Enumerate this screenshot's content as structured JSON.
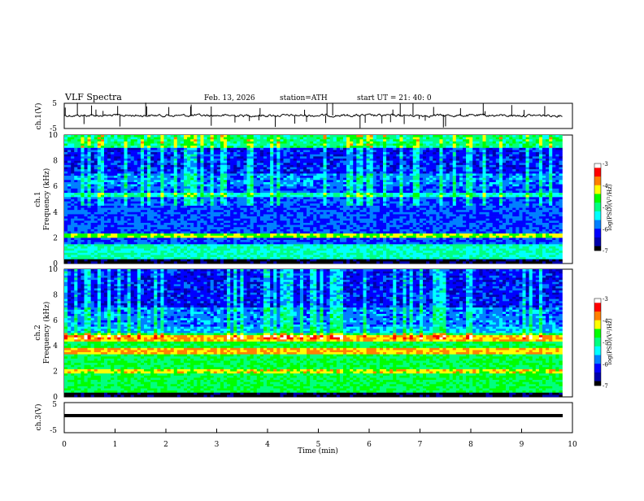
{
  "header": {
    "title": "VLF  Spectra",
    "date": "Feb. 13, 2026",
    "station": "station=ATH",
    "start_ut": "start  UT  =    21: 40: 0"
  },
  "chart_data": [
    {
      "type": "line",
      "panel": "ch1",
      "ylabel": "ch.1(V)",
      "ylim": [
        -5,
        5
      ],
      "yticks": [
        "5",
        "-5"
      ],
      "xlim": [
        0,
        10
      ],
      "series_color": "#000000",
      "description_of_signal": "noisy waveform around ~0 V with sporadic spikes"
    },
    {
      "type": "heatmap",
      "panel": "ch1-spectrogram",
      "ylabel": "ch.1\nFrequency  (kHz)",
      "ylim": [
        0,
        10
      ],
      "yticks": [
        "0",
        "2",
        "4",
        "6",
        "8",
        "10"
      ],
      "xlim": [
        0,
        9.8
      ],
      "colorbar": {
        "label": "log(PSD)(V²/Hz)",
        "range": [
          -7,
          -3
        ],
        "ticks": [
          "-3",
          "-4",
          "-5",
          "-6",
          "-7"
        ]
      }
    },
    {
      "type": "heatmap",
      "panel": "ch2-spectrogram",
      "ylabel": "ch.2\nFrequency  (kHz)",
      "ylim": [
        0,
        10
      ],
      "yticks": [
        "0",
        "2",
        "4",
        "6",
        "8",
        "10"
      ],
      "xlim": [
        0,
        9.8
      ],
      "colorbar": {
        "label": "log(PSD)(V²/Hz)",
        "range": [
          -7,
          -3
        ],
        "ticks": [
          "-3",
          "-4",
          "-5",
          "-6",
          "-7"
        ]
      }
    },
    {
      "type": "line",
      "panel": "ch3",
      "ylabel": "ch.3(V)",
      "ylim": [
        -5,
        5
      ],
      "yticks": [
        "5",
        "-5"
      ],
      "xlim": [
        0,
        10
      ],
      "series_color": "#000000"
    }
  ],
  "axes": {
    "xlabel": "Time  (min)",
    "xticks": [
      "0",
      "1",
      "2",
      "3",
      "4",
      "5",
      "6",
      "7",
      "8",
      "9",
      "10"
    ]
  },
  "labels": {
    "ch1_y": "ch.1(V)",
    "ch1_spec_y_line1": "ch.1",
    "ch1_spec_y_line2": "Frequency  (kHz)",
    "ch2_spec_y_line1": "ch.2",
    "ch2_spec_y_line2": "Frequency  (kHz)",
    "ch3_y": "ch.3(V)",
    "cb1": "log(PSD)(V²/Hz)",
    "cb2": "log(PSD)(V²/Hz)"
  },
  "ticks": {
    "ch1": [
      "5",
      "-5"
    ],
    "spec": [
      "0",
      "2",
      "4",
      "6",
      "8",
      "10"
    ],
    "ch3": [
      "5",
      "-5"
    ],
    "cb": [
      "-3",
      "-4",
      "-5",
      "-6",
      "-7"
    ],
    "time": [
      "0",
      "1",
      "2",
      "3",
      "4",
      "5",
      "6",
      "7",
      "8",
      "9",
      "10"
    ]
  },
  "colors": {
    "colormap": [
      "#000000",
      "#0000aa",
      "#0000ff",
      "#0080ff",
      "#00ffff",
      "#00ff80",
      "#00ff00",
      "#ffff00",
      "#ff8000",
      "#ff0000",
      "#ffffff"
    ]
  }
}
